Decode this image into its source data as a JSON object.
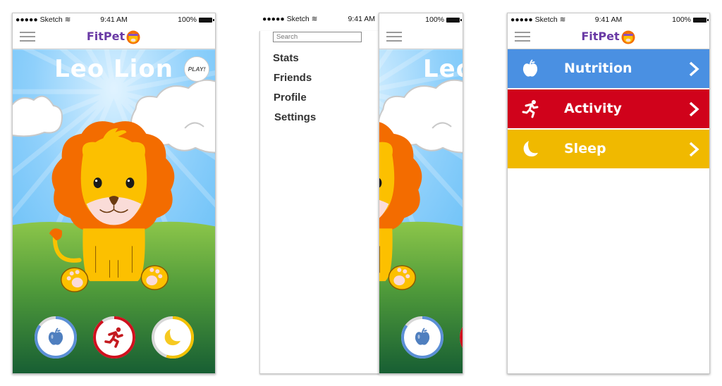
{
  "status_bar": {
    "carrier": "●●●●● Sketch",
    "wifi_icon": "wifi-icon",
    "time": "9:41 AM",
    "battery": "100%",
    "battery_icon": "battery-icon"
  },
  "header": {
    "app_name": "FitPet",
    "logo_icon": "lion-face-icon",
    "menu_icon": "hamburger-menu-icon"
  },
  "home_screen": {
    "pet_name": "Leo Lion",
    "play_label": "PLAY!",
    "progress_rings": [
      {
        "name": "nutrition",
        "icon": "apple-icon",
        "progress": 0.85,
        "color": "#5b8fd6",
        "icon_color": "#4f7fbf"
      },
      {
        "name": "activity",
        "icon": "running-person-icon",
        "progress": 0.9,
        "color": "#d0101e",
        "icon_color": "#c41a1f"
      },
      {
        "name": "sleep",
        "icon": "crescent-moon-icon",
        "progress": 0.55,
        "color": "#f2c100",
        "icon_color": "#f6c920"
      }
    ]
  },
  "menu_screen": {
    "search_placeholder": "Search",
    "items": [
      {
        "label": "Stats"
      },
      {
        "label": "Friends"
      },
      {
        "label": "Profile"
      },
      {
        "label": "Settings"
      }
    ],
    "background_title_partial": "Leo"
  },
  "categories_screen": {
    "rows": [
      {
        "label": "Nutrition",
        "icon": "apple-icon",
        "color": "#4a90e2"
      },
      {
        "label": "Activity",
        "icon": "running-person-icon",
        "color": "#d0021b"
      },
      {
        "label": "Sleep",
        "icon": "crescent-moon-icon",
        "color": "#f0b900"
      }
    ],
    "chevron_icon": "chevron-right-icon"
  }
}
